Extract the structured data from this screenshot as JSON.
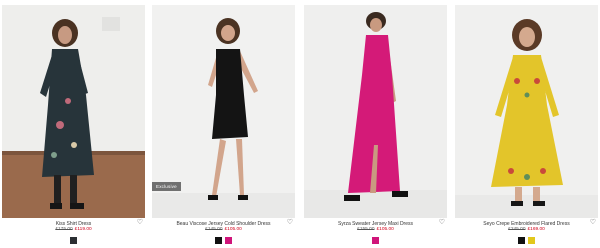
{
  "products": [
    {
      "name": "Kiss Shirt Dress",
      "was_price": "£175.00",
      "now_price": "£119.00",
      "badge": "",
      "swatches": [
        "#2b2f33"
      ]
    },
    {
      "name": "Beau Viscose Jersey Cold Shoulder Dress",
      "was_price": "£145.00",
      "now_price": "£105.00",
      "badge": "Exclusive",
      "swatches": [
        "#111111",
        "#d0157a"
      ]
    },
    {
      "name": "Syrza Sweater Jersey Maxi Dress",
      "was_price": "£155.00",
      "now_price": "£105.00",
      "badge": "",
      "swatches": [
        "#d0157a"
      ]
    },
    {
      "name": "Seyo Crepe Embroidered Flared Dress",
      "was_price": "£245.00",
      "now_price": "£169.00",
      "badge": "",
      "swatches": [
        "#111111",
        "#e2c81c"
      ]
    }
  ],
  "wishlist_icon": "heart-outline-icon"
}
